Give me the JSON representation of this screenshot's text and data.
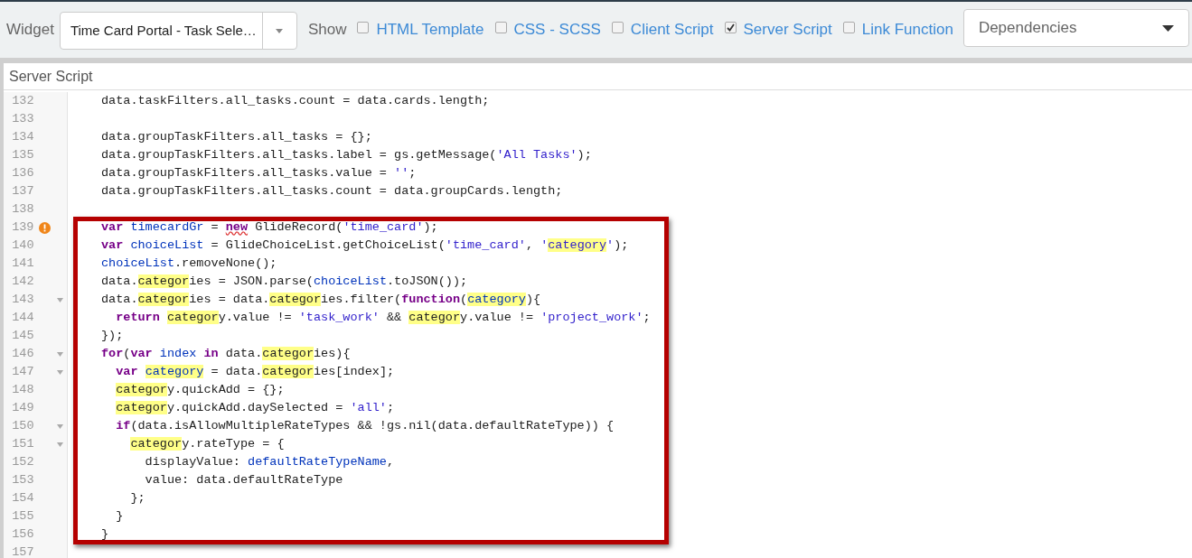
{
  "toolbar": {
    "widget_label": "Widget",
    "widget_select": "Time Card Portal - Task Sele…",
    "show_label": "Show",
    "options": [
      {
        "label": "HTML Template",
        "checked": false
      },
      {
        "label": "CSS - SCSS",
        "checked": false
      },
      {
        "label": "Client Script",
        "checked": false
      },
      {
        "label": "Server Script",
        "checked": true
      },
      {
        "label": "Link Function",
        "checked": false
      }
    ],
    "dependencies_select": "Dependencies"
  },
  "panel": {
    "title": "Server Script",
    "lines": [
      {
        "number": "132",
        "tokens": [
          {
            "text": "data.taskFilters.all_tasks.count = data.cards.length;",
            "kind": "plain"
          }
        ]
      },
      {
        "number": "133"
      },
      {
        "number": "134",
        "tokens": [
          {
            "text": "data.groupTaskFilters.all_tasks = {};",
            "kind": "plain"
          }
        ]
      },
      {
        "number": "135",
        "tokens": [
          {
            "text": "data.groupTaskFilters.all_tasks.label = gs.getMessage(",
            "kind": "plain"
          },
          {
            "text": "'All Tasks'",
            "kind": "string"
          },
          {
            "text": ");",
            "kind": "plain"
          }
        ]
      },
      {
        "number": "136",
        "tokens": [
          {
            "text": "data.groupTaskFilters.all_tasks.value = ",
            "kind": "plain"
          },
          {
            "text": "''",
            "kind": "string"
          },
          {
            "text": ";",
            "kind": "plain"
          }
        ]
      },
      {
        "number": "137",
        "tokens": [
          {
            "text": "data.groupTaskFilters.all_tasks.count = data.groupCards.length;",
            "kind": "plain"
          }
        ]
      },
      {
        "number": "138"
      },
      {
        "number": "139",
        "warning": true,
        "tokens": [
          {
            "text": "var",
            "kind": "keyword"
          },
          {
            "text": " timecardGr",
            "kind": "variable"
          },
          {
            "text": " = ",
            "kind": "plain"
          },
          {
            "text": "new",
            "kind": "error"
          },
          {
            "text": " GlideRecord(",
            "kind": "plain"
          },
          {
            "text": "'time_card'",
            "kind": "string"
          },
          {
            "text": ");",
            "kind": "plain"
          }
        ]
      },
      {
        "number": "140",
        "tokens": [
          {
            "text": "var",
            "kind": "keyword"
          },
          {
            "text": " choiceList",
            "kind": "variable"
          },
          {
            "text": " = GlideChoiceList.getChoiceList(",
            "kind": "plain"
          },
          {
            "text": "'time_card'",
            "kind": "string"
          },
          {
            "text": ", ",
            "kind": "plain"
          },
          {
            "text": "'",
            "kind": "string"
          },
          {
            "text": "category",
            "kind": "match-string"
          },
          {
            "text": "'",
            "kind": "string"
          },
          {
            "text": ");",
            "kind": "plain"
          }
        ]
      },
      {
        "number": "141",
        "tokens": [
          {
            "text": "choiceList",
            "kind": "variable"
          },
          {
            "text": ".removeNone();",
            "kind": "plain"
          }
        ]
      },
      {
        "number": "142",
        "tokens": [
          {
            "text": "data.",
            "kind": "plain"
          },
          {
            "text": "categor",
            "kind": "match"
          },
          {
            "text": "ies = JSON.parse(",
            "kind": "plain"
          },
          {
            "text": "choiceList",
            "kind": "variable"
          },
          {
            "text": ".toJSON());",
            "kind": "plain"
          }
        ]
      },
      {
        "number": "143",
        "foldable": true,
        "tokens": [
          {
            "text": "data.",
            "kind": "plain"
          },
          {
            "text": "categor",
            "kind": "match"
          },
          {
            "text": "ies = data.",
            "kind": "plain"
          },
          {
            "text": "categor",
            "kind": "match"
          },
          {
            "text": "ies.filter(",
            "kind": "plain"
          },
          {
            "text": "function",
            "kind": "keyword"
          },
          {
            "text": "(",
            "kind": "plain"
          },
          {
            "text": "category",
            "kind": "match-variable"
          },
          {
            "text": "){",
            "kind": "plain"
          }
        ]
      },
      {
        "number": "144",
        "tokens": [
          {
            "text": "  return",
            "kind": "keyword"
          },
          {
            "text": " categor",
            "kind": "match"
          },
          {
            "text": "y.value != ",
            "kind": "plain"
          },
          {
            "text": "'task_work'",
            "kind": "string"
          },
          {
            "text": " && ",
            "kind": "plain"
          },
          {
            "text": "categor",
            "kind": "match"
          },
          {
            "text": "y.value != ",
            "kind": "plain"
          },
          {
            "text": "'project_work'",
            "kind": "string"
          },
          {
            "text": ";",
            "kind": "plain"
          }
        ]
      },
      {
        "number": "145",
        "tokens": [
          {
            "text": "});",
            "kind": "plain"
          }
        ]
      },
      {
        "number": "146",
        "foldable": true,
        "tokens": [
          {
            "text": "for",
            "kind": "keyword"
          },
          {
            "text": "(",
            "kind": "plain"
          },
          {
            "text": "var",
            "kind": "keyword"
          },
          {
            "text": " index",
            "kind": "variable"
          },
          {
            "text": " in",
            "kind": "keyword"
          },
          {
            "text": " data.",
            "kind": "plain"
          },
          {
            "text": "categor",
            "kind": "match"
          },
          {
            "text": "ies){",
            "kind": "plain"
          }
        ]
      },
      {
        "number": "147",
        "foldable": true,
        "tokens": [
          {
            "text": "  var",
            "kind": "keyword"
          },
          {
            "text": " category",
            "kind": "match-variable"
          },
          {
            "text": " = data.",
            "kind": "plain"
          },
          {
            "text": "categor",
            "kind": "match"
          },
          {
            "text": "ies[index];",
            "kind": "plain"
          }
        ]
      },
      {
        "number": "148",
        "tokens": [
          {
            "text": "  categor",
            "kind": "match"
          },
          {
            "text": "y.quickAdd = {};",
            "kind": "plain"
          }
        ]
      },
      {
        "number": "149",
        "tokens": [
          {
            "text": "  categor",
            "kind": "match"
          },
          {
            "text": "y.quickAdd.daySelected = ",
            "kind": "plain"
          },
          {
            "text": "'all'",
            "kind": "string"
          },
          {
            "text": ";",
            "kind": "plain"
          }
        ]
      },
      {
        "number": "150",
        "foldable": true,
        "tokens": [
          {
            "text": "  if",
            "kind": "keyword"
          },
          {
            "text": "(data.isAllowMultipleRateTypes && !gs.nil(data.defaultRateType)) {",
            "kind": "plain"
          }
        ]
      },
      {
        "number": "151",
        "foldable": true,
        "tokens": [
          {
            "text": "    categor",
            "kind": "match"
          },
          {
            "text": "y.rateType = {",
            "kind": "plain"
          }
        ]
      },
      {
        "number": "152",
        "tokens": [
          {
            "text": "      displayValue: ",
            "kind": "plain"
          },
          {
            "text": "defaultRateTypeName",
            "kind": "variable"
          },
          {
            "text": ",",
            "kind": "plain"
          }
        ]
      },
      {
        "number": "153",
        "tokens": [
          {
            "text": "      value: data.defaultRateType",
            "kind": "plain"
          }
        ]
      },
      {
        "number": "154",
        "tokens": [
          {
            "text": "    };",
            "kind": "plain"
          }
        ]
      },
      {
        "number": "155",
        "tokens": [
          {
            "text": "  }",
            "kind": "plain"
          }
        ]
      },
      {
        "number": "156",
        "tokens": [
          {
            "text": "}",
            "kind": "plain"
          }
        ]
      },
      {
        "number": "157"
      }
    ]
  }
}
